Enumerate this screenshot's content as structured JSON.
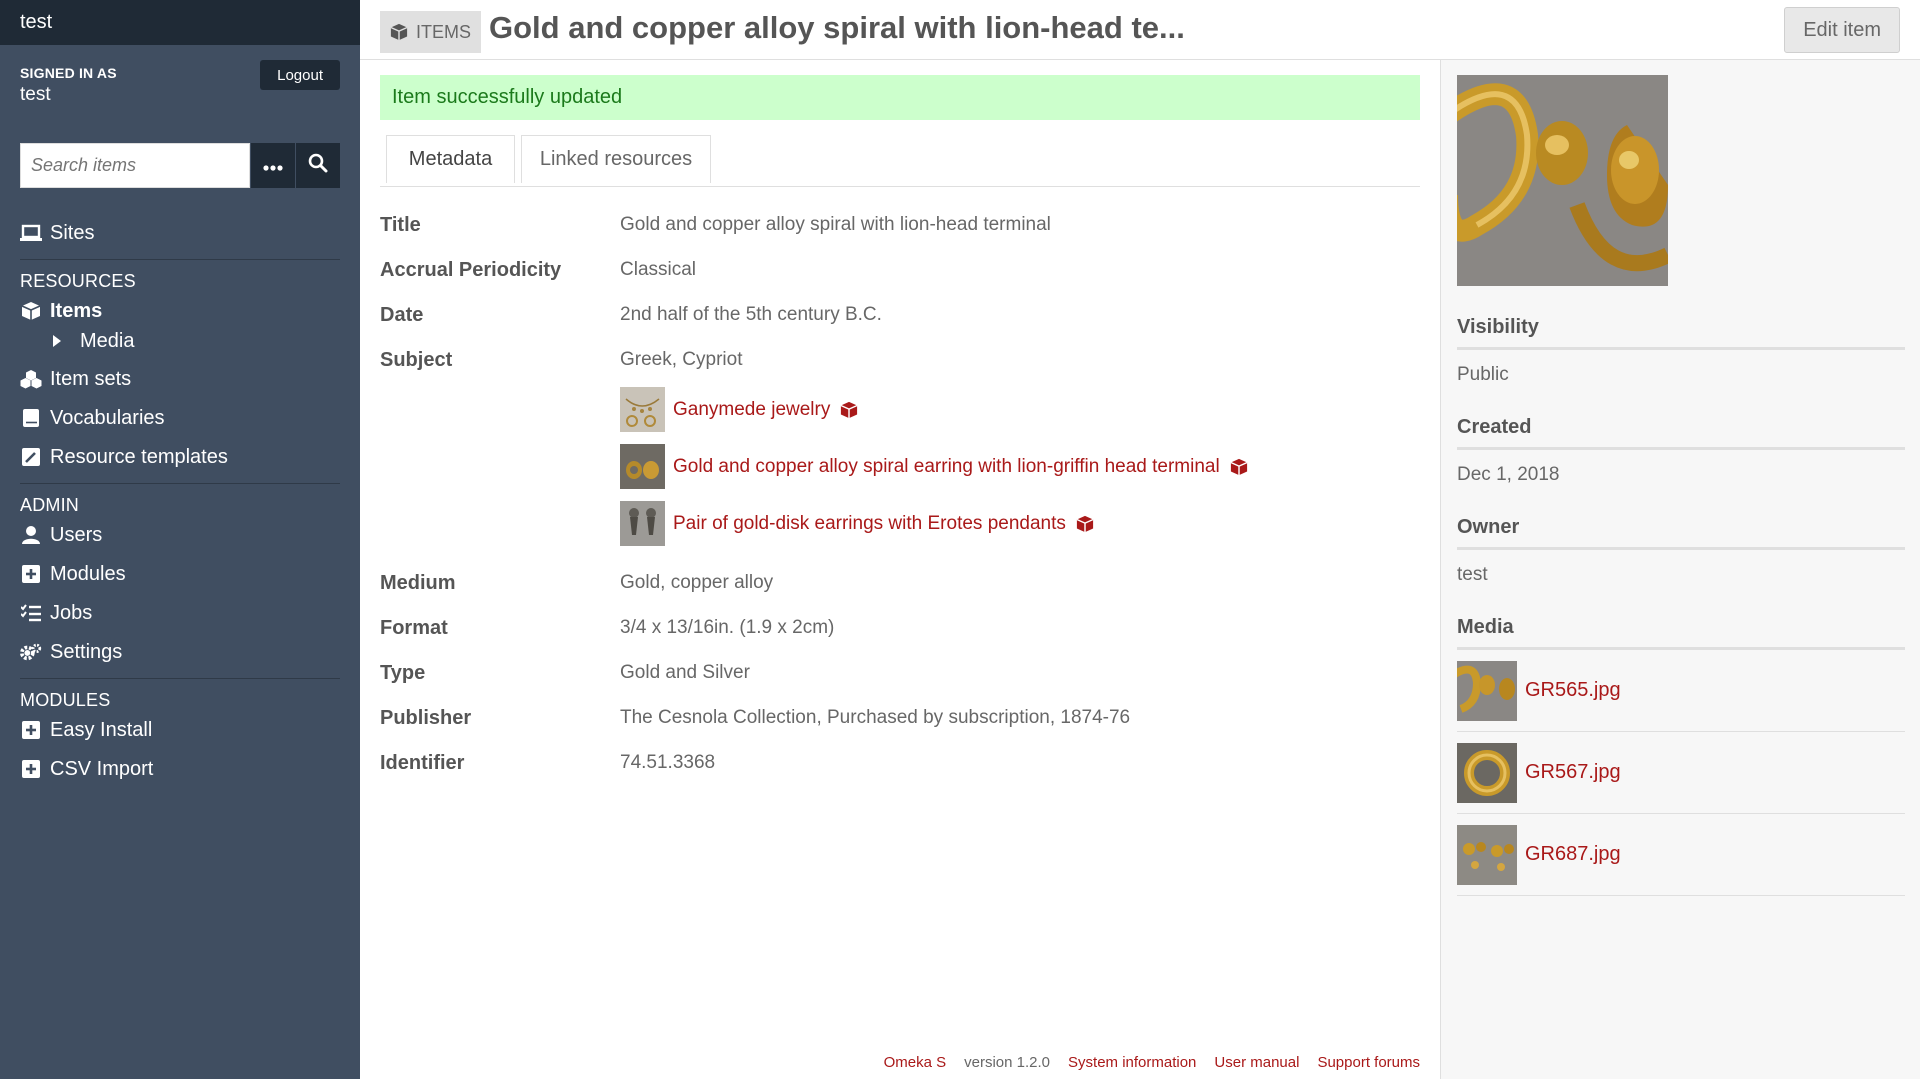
{
  "sidebar": {
    "install_name": "test",
    "signed_in_label": "SIGNED IN AS",
    "username": "test",
    "logout_label": "Logout",
    "search_placeholder": "Search items",
    "nav": {
      "sites": "Sites",
      "resources_heading": "RESOURCES",
      "items": "Items",
      "media": "Media",
      "item_sets": "Item sets",
      "vocabularies": "Vocabularies",
      "resource_templates": "Resource templates",
      "admin_heading": "ADMIN",
      "users": "Users",
      "modules": "Modules",
      "jobs": "Jobs",
      "settings": "Settings",
      "modules_heading": "MODULES",
      "easy_install": "Easy Install",
      "csv_import": "CSV Import"
    }
  },
  "header": {
    "type_label": "ITEMS",
    "title": "Gold and copper alloy spiral with lion-head te...",
    "edit_label": "Edit item"
  },
  "main": {
    "flash": "Item successfully updated",
    "tabs": [
      "Metadata",
      "Linked resources"
    ],
    "properties": {
      "title": {
        "label": "Title",
        "value": "Gold and copper alloy spiral with lion-head terminal"
      },
      "accrual": {
        "label": "Accrual Periodicity",
        "value": "Classical"
      },
      "date": {
        "label": "Date",
        "value": "2nd half of the 5th century B.C."
      },
      "subject": {
        "label": "Subject",
        "value": "Greek, Cypriot",
        "links": [
          "Ganymede jewelry",
          "Gold and copper alloy spiral earring with lion-griffin head terminal",
          "Pair of gold-disk earrings with Erotes pendants"
        ]
      },
      "medium": {
        "label": "Medium",
        "value": "Gold, copper alloy"
      },
      "format": {
        "label": "Format",
        "value": "3/4 x 13/16in. (1.9 x 2cm)"
      },
      "type": {
        "label": "Type",
        "value": "Gold and Silver"
      },
      "publisher": {
        "label": "Publisher",
        "value": "The Cesnola Collection, Purchased by subscription, 1874-76"
      },
      "identifier": {
        "label": "Identifier",
        "value": "74.51.3368"
      }
    },
    "footer": {
      "brand": "Omeka S",
      "version": "version 1.2.0",
      "system_info": "System information",
      "user_manual": "User manual",
      "support": "Support forums"
    }
  },
  "aside": {
    "visibility_label": "Visibility",
    "visibility_value": "Public",
    "created_label": "Created",
    "created_value": "Dec 1, 2018",
    "owner_label": "Owner",
    "owner_value": "test",
    "media_label": "Media",
    "media": [
      "GR565.jpg",
      "GR567.jpg",
      "GR687.jpg"
    ]
  },
  "colors": {
    "sidebar_bg": "#404e61",
    "sidebar_dark": "#1f2a36",
    "link": "#a91919",
    "flash_bg": "#ccffcc"
  }
}
